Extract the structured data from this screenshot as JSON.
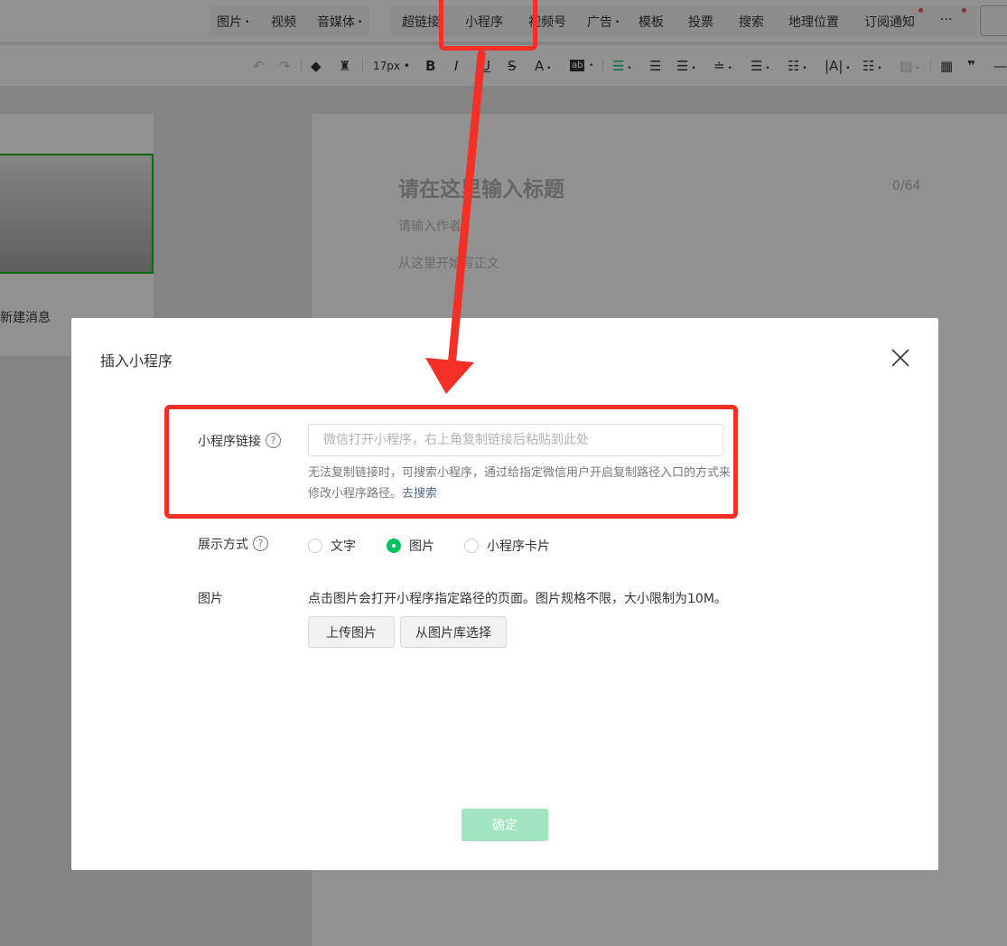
{
  "top_menu": {
    "items": [
      {
        "label": "图片",
        "caret": true
      },
      {
        "label": "视频",
        "caret": false
      },
      {
        "label": "音媒体",
        "caret": true
      },
      {
        "label": "超链接",
        "caret": false
      },
      {
        "label": "小程序",
        "caret": false
      },
      {
        "label": "视频号",
        "caret": false
      },
      {
        "label": "广告",
        "caret": true
      },
      {
        "label": "模板",
        "caret": false
      },
      {
        "label": "投票",
        "caret": false
      },
      {
        "label": "搜索",
        "caret": false
      },
      {
        "label": "地理位置",
        "caret": false
      },
      {
        "label": "订阅通知",
        "caret": false
      }
    ],
    "more_label": "···"
  },
  "format_toolbar": {
    "font_size": "17px",
    "bold": "B",
    "italic": "I",
    "underline": "U",
    "strike": "S",
    "font_color": "A",
    "bg_color": "ab",
    "quote": "❞"
  },
  "left_panel": {
    "new_message_label": "新建消息"
  },
  "editor": {
    "title_placeholder": "请在这里输入标题",
    "title_count": "0/64",
    "author_placeholder": "请输入作者",
    "body_placeholder": "从这里开始写正文"
  },
  "dialog": {
    "title": "插入小程序",
    "link_label": "小程序链接",
    "link_placeholder": "微信打开小程序，右上角复制链接后粘贴到此处",
    "link_value": "",
    "tip_text": "无法复制链接时，可搜索小程序，通过给指定微信用户开启复制路径入口的方式来修改小程序路径。",
    "tip_link": "去搜索",
    "display_label": "展示方式",
    "display_options": [
      {
        "label": "文字",
        "checked": false
      },
      {
        "label": "图片",
        "checked": true
      },
      {
        "label": "小程序卡片",
        "checked": false
      }
    ],
    "image_label": "图片",
    "image_desc": "点击图片会打开小程序指定路径的页面。图片规格不限，大小限制为10M。",
    "upload_button": "上传图片",
    "library_button": "从图片库选择",
    "confirm_button": "确定"
  },
  "colors": {
    "accent_green": "#07c160",
    "annotation_red": "#f32f26",
    "link_blue": "#576b95",
    "confirm_disabled": "#9fe6bf"
  }
}
